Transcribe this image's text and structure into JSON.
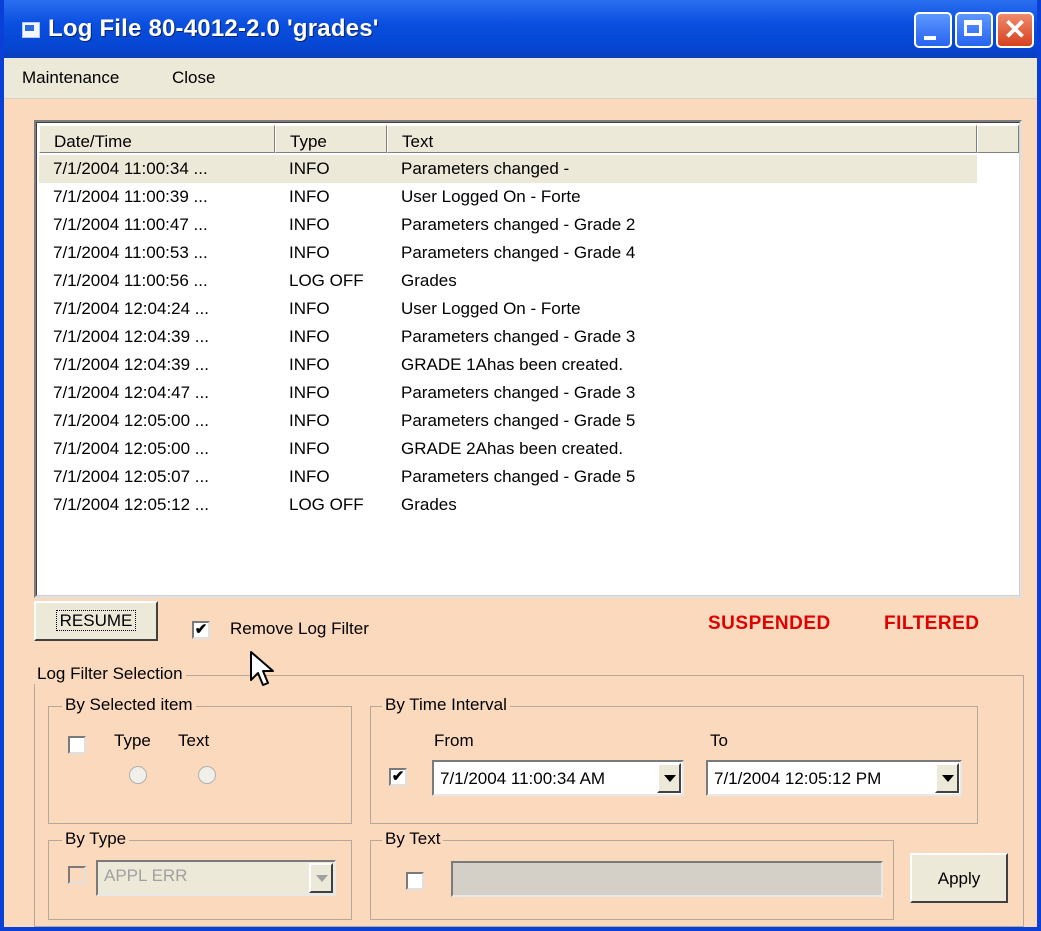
{
  "window": {
    "title": "Log File 80-4012-2.0 'grades'"
  },
  "menu": {
    "items": [
      "Maintenance",
      "Close"
    ]
  },
  "log": {
    "columns": [
      "Date/Time",
      "Type",
      "Text"
    ],
    "rows": [
      {
        "datetime": "7/1/2004 11:00:34 ...",
        "type": "INFO",
        "text": "Parameters changed -"
      },
      {
        "datetime": "7/1/2004 11:00:39 ...",
        "type": "INFO",
        "text": "User Logged On - Forte"
      },
      {
        "datetime": "7/1/2004 11:00:47 ...",
        "type": "INFO",
        "text": "Parameters changed - Grade 2"
      },
      {
        "datetime": "7/1/2004 11:00:53 ...",
        "type": "INFO",
        "text": "Parameters changed - Grade 4"
      },
      {
        "datetime": "7/1/2004 11:00:56 ...",
        "type": "LOG OFF",
        "text": "Grades"
      },
      {
        "datetime": "7/1/2004 12:04:24 ...",
        "type": "INFO",
        "text": "User Logged On - Forte"
      },
      {
        "datetime": "7/1/2004 12:04:39 ...",
        "type": "INFO",
        "text": "Parameters changed - Grade 3"
      },
      {
        "datetime": "7/1/2004 12:04:39 ...",
        "type": "INFO",
        "text": "GRADE 1Ahas been created."
      },
      {
        "datetime": "7/1/2004 12:04:47 ...",
        "type": "INFO",
        "text": "Parameters changed - Grade 3"
      },
      {
        "datetime": "7/1/2004 12:05:00 ...",
        "type": "INFO",
        "text": "Parameters changed - Grade 5"
      },
      {
        "datetime": "7/1/2004 12:05:00 ...",
        "type": "INFO",
        "text": "GRADE 2Ahas been created."
      },
      {
        "datetime": "7/1/2004 12:05:07 ...",
        "type": "INFO",
        "text": "Parameters changed - Grade 5"
      },
      {
        "datetime": "7/1/2004 12:05:12 ...",
        "type": "LOG OFF",
        "text": "Grades"
      }
    ]
  },
  "controls": {
    "resume_label": "RESUME",
    "remove_filter_label": "Remove Log Filter",
    "remove_filter_checked": true,
    "status_suspended": "SUSPENDED",
    "status_filtered": "FILTERED",
    "status_color": "#e00000"
  },
  "filter": {
    "title": "Log Filter Selection",
    "by_selected": {
      "title": "By Selected item",
      "type_label": "Type",
      "text_label": "Text",
      "checked": false
    },
    "by_time": {
      "title": "By Time Interval",
      "from_label": "From",
      "to_label": "To",
      "checked": true,
      "from_value": "7/1/2004 11:00:34 AM",
      "to_value": "7/1/2004 12:05:12 PM"
    },
    "by_type": {
      "title": "By Type",
      "value": "APPL ERR",
      "checked": false
    },
    "by_text": {
      "title": "By Text",
      "value": "",
      "checked": false
    },
    "apply_label": "Apply"
  },
  "icons": {
    "window": "app-window-icon",
    "cursor": "arrow-cursor-icon"
  },
  "colors": {
    "window_bg": "#fbd9bd",
    "titlebar": "#0546d3"
  }
}
